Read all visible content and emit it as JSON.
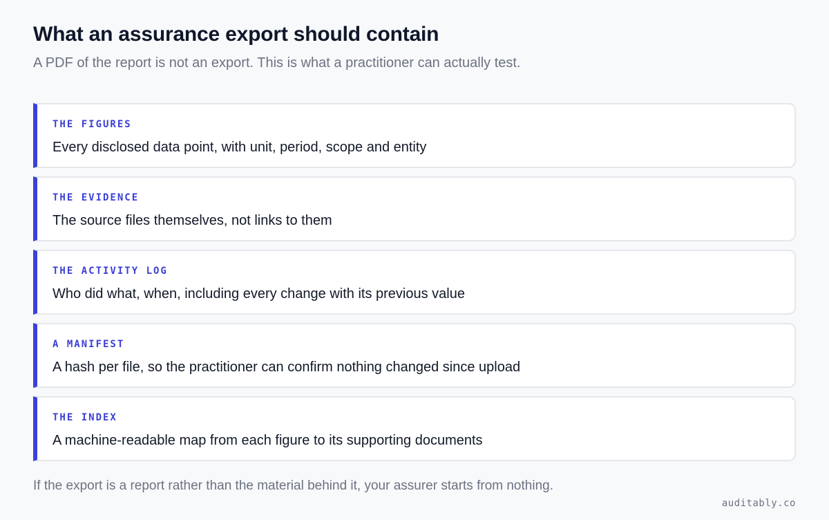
{
  "header": {
    "title": "What an assurance export should contain",
    "subtitle": "A PDF of the report is not an export. This is what a practitioner can actually test."
  },
  "items": [
    {
      "label": "THE FIGURES",
      "text": "Every disclosed data point, with unit, period, scope and entity"
    },
    {
      "label": "THE EVIDENCE",
      "text": "The source files themselves, not links to them"
    },
    {
      "label": "THE ACTIVITY LOG",
      "text": "Who did what, when, including every change with its previous value"
    },
    {
      "label": "A MANIFEST",
      "text": "A hash per file, so the practitioner can confirm nothing changed since upload"
    },
    {
      "label": "THE INDEX",
      "text": "A machine-readable map from each figure to its supporting documents"
    }
  ],
  "footer": {
    "note": "If the export is a report rather than the material behind it, your assurer starts from nothing.",
    "brand": "auditably.co"
  },
  "colors": {
    "background": "#f8f9fb",
    "accent": "#3b41d8",
    "label": "#3b3fd3",
    "muted_text": "#6b7280"
  }
}
